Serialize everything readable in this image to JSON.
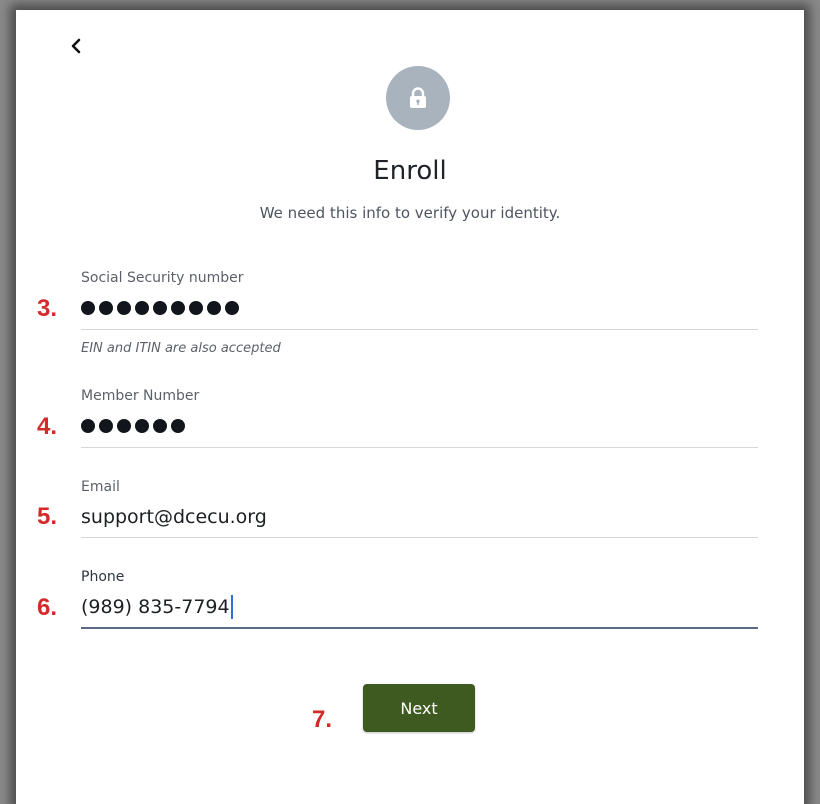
{
  "header": {
    "back_icon": "chevron-left-icon",
    "lock_icon": "lock-icon",
    "title": "Enroll",
    "subtitle": "We need this info to verify your identity."
  },
  "form": {
    "fields": [
      {
        "step": "3.",
        "label": "Social Security number",
        "value": "",
        "masked_dot_count": 9,
        "helper": "EIN and ITIN are also accepted"
      },
      {
        "step": "4.",
        "label": "Member Number",
        "value": "",
        "masked_dot_count": 6
      },
      {
        "step": "5.",
        "label": "Email",
        "value": "support@dcecu.org"
      },
      {
        "step": "6.",
        "label": "Phone",
        "value": "(989) 835-7794",
        "focused": true
      }
    ]
  },
  "actions": {
    "step": "7.",
    "next_label": "Next"
  },
  "colors": {
    "accent_button": "#3f5a20",
    "step_annotation": "#d42a2a",
    "lock_circle": "#a9b3be",
    "caret": "#2f6fd8"
  }
}
